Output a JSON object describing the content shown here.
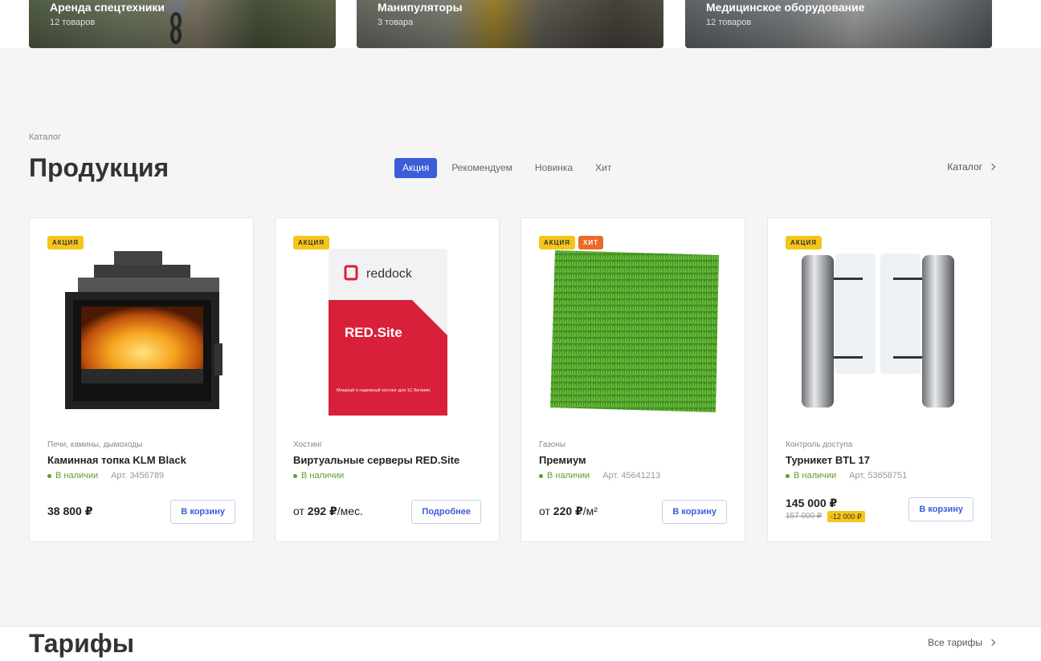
{
  "categories": [
    {
      "title": "Аренда спецтехники",
      "count": "12 товаров"
    },
    {
      "title": "Манипуляторы",
      "count": "3 товара"
    },
    {
      "title": "Медицинское оборудование",
      "count": "12 товаров"
    }
  ],
  "breadcrumb": "Каталог",
  "section_title": "Продукция",
  "tabs": [
    "Акция",
    "Рекомендуем",
    "Новинка",
    "Хит"
  ],
  "catalog_link": "Каталог",
  "products": [
    {
      "badges": [
        "Акция"
      ],
      "category": "Печи, камины, дымоходы",
      "name": "Каминная топка KLM Black",
      "stock": "В наличии",
      "article": "Арт. 3456789",
      "price": "38 800 ₽",
      "button": "В корзину"
    },
    {
      "badges": [
        "Акция"
      ],
      "category": "Хостинг",
      "name": "Виртуальные серверы RED.Site",
      "stock": "В наличии",
      "article": "",
      "price_prefix": "от",
      "price_value": "292 ₽",
      "price_unit": "/мес.",
      "button": "Подробнее",
      "image_text": {
        "brand": "reddock",
        "product": "RED.Site",
        "tagline": "Мощный и надежный хостинг для 1С-Битрикс"
      }
    },
    {
      "badges": [
        "Акция",
        "Хит"
      ],
      "category": "Газоны",
      "name": "Премиум",
      "stock": "В наличии",
      "article": "Арт. 45641213",
      "price_prefix": "от",
      "price_value": "220 ₽",
      "price_unit": "/м²",
      "button": "В корзину"
    },
    {
      "badges": [
        "Акция"
      ],
      "category": "Контроль доступа",
      "name": "Турникет BTL 17",
      "stock": "В наличии",
      "article": "Арт. 53658751",
      "price": "145 000 ₽",
      "old_price": "157 000 ₽",
      "discount": "-12 000 ₽",
      "button": "В корзину"
    }
  ],
  "tariffs_title": "Тарифы",
  "all_tariffs": "Все тарифы",
  "colors": {
    "accent": "#3a5ed9",
    "sale_badge": "#f5c518",
    "hit_badge": "#ea6a2a",
    "in_stock": "#5aa02c"
  }
}
